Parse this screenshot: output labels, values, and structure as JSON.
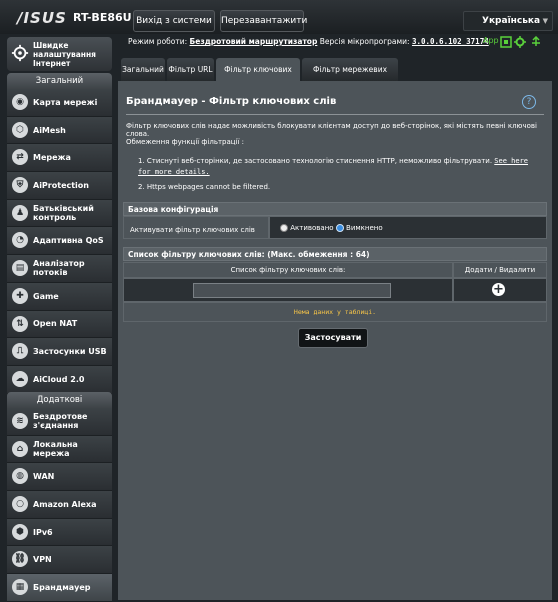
{
  "header": {
    "logo": "/ISUS",
    "model": "RT-BE86U",
    "logout_label": "Вихід з системи",
    "reboot_label": "Перезавантажити",
    "language": "Українська",
    "mode_label": "Режим роботи:",
    "mode_value": "Бездротовий маршрутизатор",
    "firmware_label": "Версія мікропрограми:",
    "firmware_value": "3.0.0.6.102_37174",
    "status_app": "App"
  },
  "sidebar": {
    "qis_label": "Швидке налаштування Інтернет",
    "general_title": "Загальний",
    "general_items": [
      {
        "label": "Карта мережі",
        "icon": "map"
      },
      {
        "label": "AiMesh",
        "icon": "mesh"
      },
      {
        "label": "Мережа",
        "icon": "network"
      },
      {
        "label": "AiProtection",
        "icon": "shield"
      },
      {
        "label": "Батьківський контроль",
        "icon": "family"
      },
      {
        "label": "Адаптивна QoS",
        "icon": "qos"
      },
      {
        "label": "Аналізатор потоків",
        "icon": "chart"
      },
      {
        "label": "Game",
        "icon": "gamepad"
      },
      {
        "label": "Open NAT",
        "icon": "nat"
      },
      {
        "label": "Застосунки USB",
        "icon": "usb"
      },
      {
        "label": "AiCloud 2.0",
        "icon": "cloud"
      }
    ],
    "advanced_title": "Додаткові налаштування",
    "advanced_items": [
      {
        "label": "Бездротове з'єднання",
        "icon": "wifi"
      },
      {
        "label": "Локальна мережа",
        "icon": "home"
      },
      {
        "label": "WAN",
        "icon": "globe"
      },
      {
        "label": "Amazon Alexa",
        "icon": "alexa"
      },
      {
        "label": "IPv6",
        "icon": "ipv6"
      },
      {
        "label": "VPN",
        "icon": "vpn"
      },
      {
        "label": "Брандмауер",
        "icon": "firewall"
      }
    ]
  },
  "tabs": [
    "Загальний",
    "Фільтр URL",
    "Фільтр ключових слів",
    "Фільтр мережевих служб"
  ],
  "main": {
    "title": "Брандмауер - Фільтр ключових слів",
    "description": "Фільтр ключових слів надає можливість блокувати клієнтам доступ до веб-сторінок, які містять певні ключові слова.",
    "limits_title": "Обмеження функції фільтрації :",
    "limit_1": "Стиснуті веб-сторінки, де застосовано технологію стиснення HTTP, неможливо фільтрувати.",
    "limit_1_link": "See here for more details.",
    "limit_2": "Https webpages cannot be filtered.",
    "basic_config_title": "Базова конфігурація",
    "enable_label": "Активувати фільтр ключових слів",
    "option_on": "Активовано",
    "option_off": "Вимкнено",
    "list_title": "Список фільтру ключових слів: (Макс. обмеження : 64)",
    "col_keyword": "Список фільтру ключових слів:",
    "col_actions": "Додати / Видалити",
    "empty_text": "Нема даних у таблиці.",
    "apply_label": "Застосувати"
  }
}
